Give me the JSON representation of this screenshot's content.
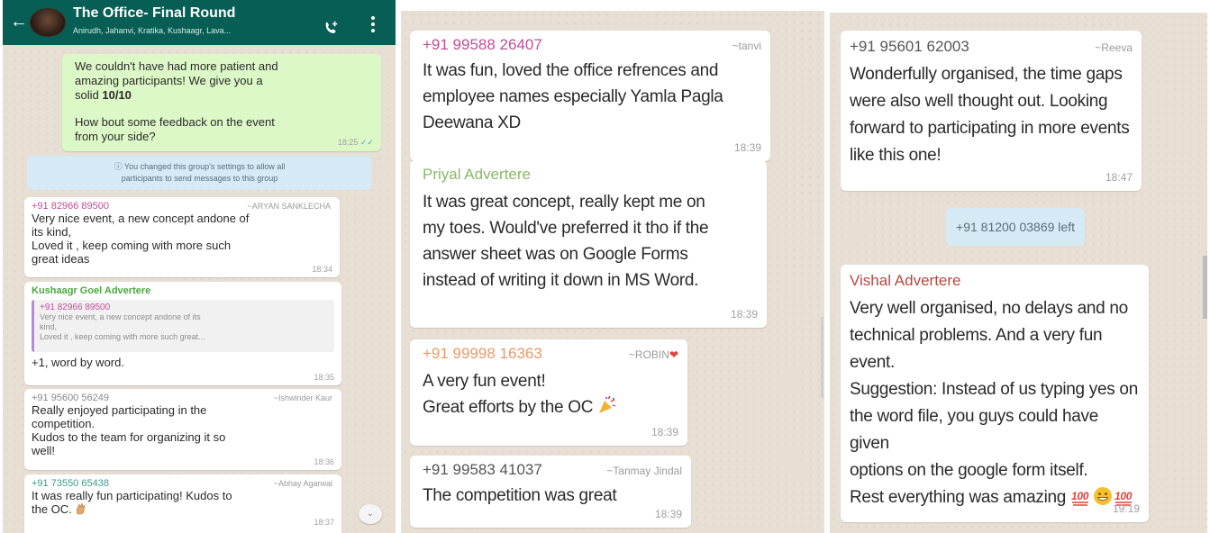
{
  "chat": {
    "title": "The Office- Final Round",
    "members": "Anirudh, Jahanvi, Kratika, Kushaagr, Lava..."
  },
  "panel1": {
    "out_message": {
      "line1": "We couldn't have had more patient and",
      "line2": "amazing participants! We give you a",
      "line3_prefix": "solid ",
      "line3_bold": "10/10",
      "line4": "How bout some feedback on the event",
      "line5": "from your side?",
      "time": "18:25"
    },
    "system": {
      "line1": "You changed this group's settings to allow all",
      "line2": "participants to send messages to this group"
    },
    "m1": {
      "sender": "+91 82966 89500",
      "alias": "~ARYAN SANKLECHA",
      "line1": "Very nice event, a new concept andone of",
      "line2": "its kind,",
      "line3": "Loved it , keep coming with more such",
      "line4": "great ideas",
      "time": "18:34"
    },
    "m2": {
      "sender": "Kushaagr Goel Advertere",
      "quote_sender": "+91 82966 89500",
      "quote_line1": "Very nice event, a new concept andone of its",
      "quote_line2": "kind,",
      "quote_line3": "Loved it , keep coming with more such great...",
      "text": "+1, word by word.",
      "time": "18:35"
    },
    "m3": {
      "sender": "+91 95600 56249",
      "alias": "~Ishwinder Kaur",
      "line1": "Really enjoyed participating in the",
      "line2": "competition.",
      "line3": "Kudos to the team for organizing it so",
      "line4": "well!",
      "time": "18:36"
    },
    "m4": {
      "sender": "+91 73550 65438",
      "alias": "~Abhay Agarwal",
      "line1": "It was really fun participating! Kudos to",
      "line2": "the OC.",
      "time": "18:37"
    }
  },
  "panel2": {
    "m1": {
      "sender": "+91 99588 26407",
      "alias": "~tanvi",
      "line1": "It was fun, loved the office refrences and",
      "line2": "employee names especially Yamla Pagla",
      "line3": "Deewana XD",
      "time": "18:39"
    },
    "m2": {
      "sender": "Priyal Advertere",
      "line1": "It was great concept, really kept me on",
      "line2": "my toes. Would've preferred it tho if the",
      "line3": "answer sheet was on Google Forms",
      "line4": "instead of writing it down in MS Word.",
      "time": "18:39"
    },
    "m3": {
      "sender": "+91 99998 16363",
      "alias": "~ROBIN",
      "line1": "A very fun event!",
      "line2": "Great efforts by the OC",
      "time": "18:39"
    },
    "m4": {
      "sender": "+91 99583 41037",
      "alias": "~Tanmay Jindal",
      "line1": "The competition was great",
      "time": "18:39"
    }
  },
  "panel3": {
    "m1": {
      "sender": "+91 95601 62003",
      "alias": "~Reeva",
      "line1": "Wonderfully organised, the time gaps",
      "line2": "were also well thought out. Looking",
      "line3": "forward to participating in more events",
      "line4": "like this one!",
      "time": "18:47"
    },
    "system": "+91 81200 03869 left",
    "m2": {
      "sender": "Vishal Advertere",
      "line1": "Very well organised, no delays and no",
      "line2": "technical problems. And a very fun event.",
      "line3": "Suggestion: Instead of us typing yes on",
      "line4": "the word file, you guys could have given",
      "line5": "options on the google form itself.",
      "line6": "Rest everything was amazing",
      "time": "19:19"
    }
  },
  "colors": {
    "header": "#075e54",
    "outgoing_bubble": "#dcf8c6",
    "system_bubble": "#d5eaf5",
    "chat_background": "#e7ded4"
  }
}
